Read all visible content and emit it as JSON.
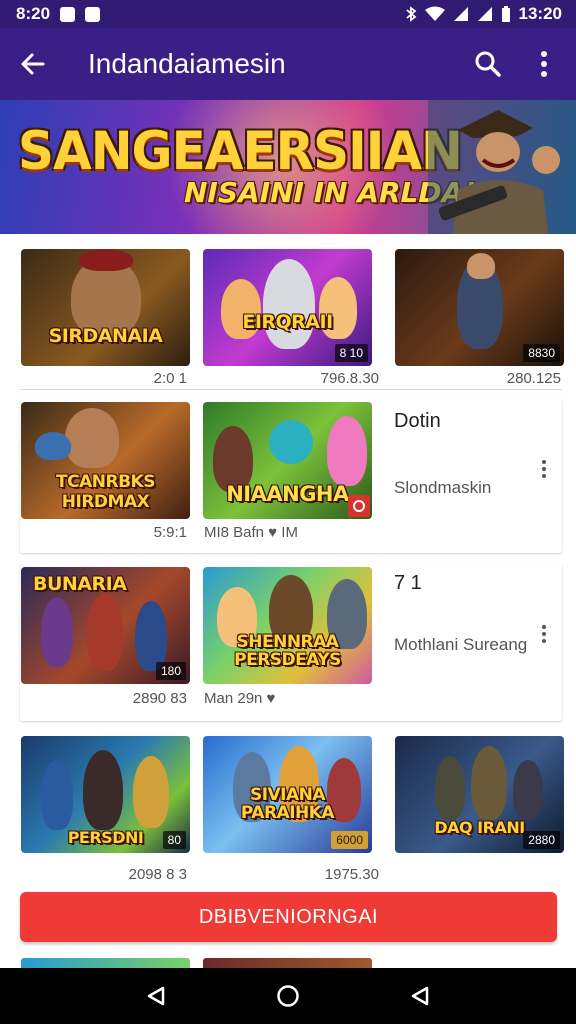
{
  "status_bar": {
    "time": "8:20",
    "clock": "13:20"
  },
  "app_bar": {
    "title": "Indandaiamesin"
  },
  "banner": {
    "title": "SANGEAERSIIAN",
    "subtitle": "NISAINI IN ARLDA!"
  },
  "rows": [
    {
      "cards": [
        {
          "label": "SIRDANAIA",
          "badge": "",
          "meta": "2:0 1"
        },
        {
          "label": "EIRQRAII",
          "badge": "8 10",
          "meta": "796.8.30"
        },
        {
          "label": "",
          "badge": "8830",
          "meta": "280.125"
        }
      ]
    },
    {
      "cards": [
        {
          "label": "TCANRBKS HIRDMAX",
          "badge": "",
          "meta": "5:9:1"
        },
        {
          "label": "NIAANGHA",
          "badge": "",
          "meta": "MI8 Bafn ♥ IM"
        }
      ],
      "side": {
        "title": "Dotin",
        "subtitle": "Slondmaskin"
      }
    },
    {
      "cards": [
        {
          "label": "BUNARIA",
          "badge": "180",
          "meta": "2890 83"
        },
        {
          "label": "SHENNRAA PERSDEAYS",
          "badge": "",
          "meta": "Man 29n ♥"
        }
      ],
      "side": {
        "title": "7 1",
        "subtitle": "Mothlani Sureang"
      }
    },
    {
      "cards": [
        {
          "label": "PERSDNI",
          "badge": "80",
          "meta": "2098 8 3"
        },
        {
          "label": "SIVIANA PARAIHKA",
          "badge": "6000",
          "meta": "1975.30"
        },
        {
          "label": "DAQ IRANI",
          "badge": "2880",
          "meta": ""
        }
      ]
    }
  ],
  "cta": {
    "label": "DBIBVENIORNGAI"
  },
  "colors": {
    "app_bar": "#3a1f86",
    "status_bar": "#311b73",
    "cta": "#ef3a35"
  }
}
